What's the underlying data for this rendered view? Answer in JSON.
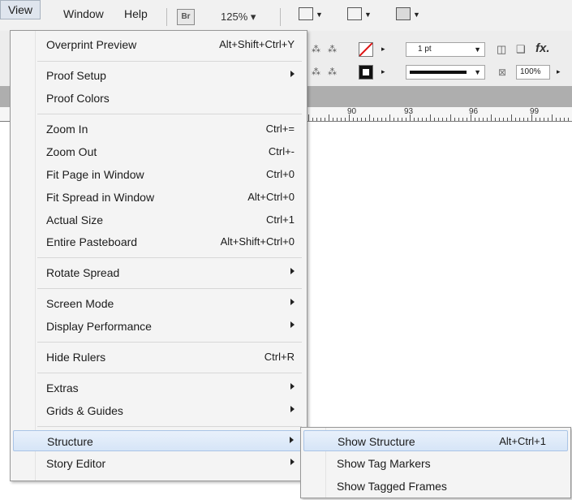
{
  "menubar": {
    "items": [
      {
        "label": "View"
      },
      {
        "label": "Window"
      },
      {
        "label": "Help"
      }
    ],
    "bridge_badge": "Br",
    "zoom": "125% ▾"
  },
  "control_panel": {
    "stroke_weight": "1 pt",
    "opacity": "100%",
    "fx": "fx."
  },
  "ruler": {
    "labels": [
      "90",
      "93",
      "96",
      "99"
    ]
  },
  "view_menu": {
    "items": [
      {
        "label": "Overprint Preview",
        "shortcut": "Alt+Shift+Ctrl+Y"
      },
      {
        "label": "Proof Setup",
        "submenu": true
      },
      {
        "label": "Proof Colors"
      },
      {
        "label": "Zoom In",
        "shortcut": "Ctrl+="
      },
      {
        "label": "Zoom Out",
        "shortcut": "Ctrl+-"
      },
      {
        "label": "Fit Page in Window",
        "shortcut": "Ctrl+0"
      },
      {
        "label": "Fit Spread in Window",
        "shortcut": "Alt+Ctrl+0"
      },
      {
        "label": "Actual Size",
        "shortcut": "Ctrl+1"
      },
      {
        "label": "Entire Pasteboard",
        "shortcut": "Alt+Shift+Ctrl+0"
      },
      {
        "label": "Rotate Spread",
        "submenu": true
      },
      {
        "label": "Screen Mode",
        "submenu": true
      },
      {
        "label": "Display Performance",
        "submenu": true
      },
      {
        "label": "Hide Rulers",
        "shortcut": "Ctrl+R"
      },
      {
        "label": "Extras",
        "submenu": true
      },
      {
        "label": "Grids & Guides",
        "submenu": true
      },
      {
        "label": "Structure",
        "submenu": true,
        "highlighted": true
      },
      {
        "label": "Story Editor",
        "submenu": true
      }
    ]
  },
  "structure_submenu": {
    "items": [
      {
        "label": "Show Structure",
        "shortcut": "Alt+Ctrl+1",
        "highlighted": true
      },
      {
        "label": "Show Tag Markers"
      },
      {
        "label": "Show Tagged Frames"
      }
    ]
  },
  "colors": {
    "highlight_border": "#a9c4e6",
    "highlight_fill": "#dce8f7",
    "menu_bg": "#f4f4f4"
  }
}
